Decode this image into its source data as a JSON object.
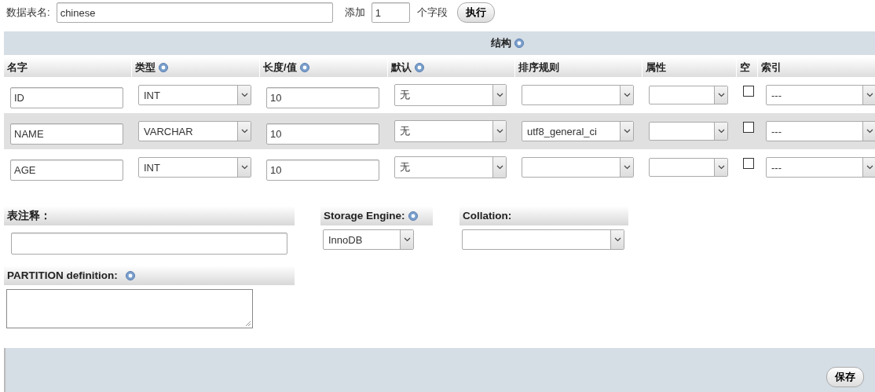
{
  "table_name": {
    "label": "数据表名:",
    "value": "chinese"
  },
  "add_fields": {
    "label": "添加",
    "value": "1",
    "suffix": "个字段",
    "button": "执行"
  },
  "structure": {
    "title": "结构",
    "help": true,
    "columns": [
      {
        "label": "名字",
        "help": false
      },
      {
        "label": "类型",
        "help": true
      },
      {
        "label": "长度/值",
        "help": true
      },
      {
        "label": "默认",
        "help": true
      },
      {
        "label": "排序规则",
        "help": false
      },
      {
        "label": "属性",
        "help": false
      },
      {
        "label": "空",
        "help": false
      },
      {
        "label": "索引",
        "help": false
      }
    ],
    "rows": [
      {
        "name": "ID",
        "type": "INT",
        "length": "10",
        "default": "无",
        "null": false,
        "index": "---"
      },
      {
        "name": "NAME",
        "type": "VARCHAR",
        "length": "10",
        "default": "无",
        "collation": "utf8_general_ci",
        "null": false,
        "index": "---"
      },
      {
        "name": "AGE",
        "type": "INT",
        "length": "10",
        "default": "无",
        "null": false,
        "index": "---"
      }
    ]
  },
  "comment": {
    "label": "表注释："
  },
  "storage_engine": {
    "label": "Storage Engine:",
    "help": true,
    "value": "InnoDB"
  },
  "collation": {
    "label": "Collation:"
  },
  "partition": {
    "label": "PARTITION definition:",
    "help": true
  },
  "save_button": "保存"
}
